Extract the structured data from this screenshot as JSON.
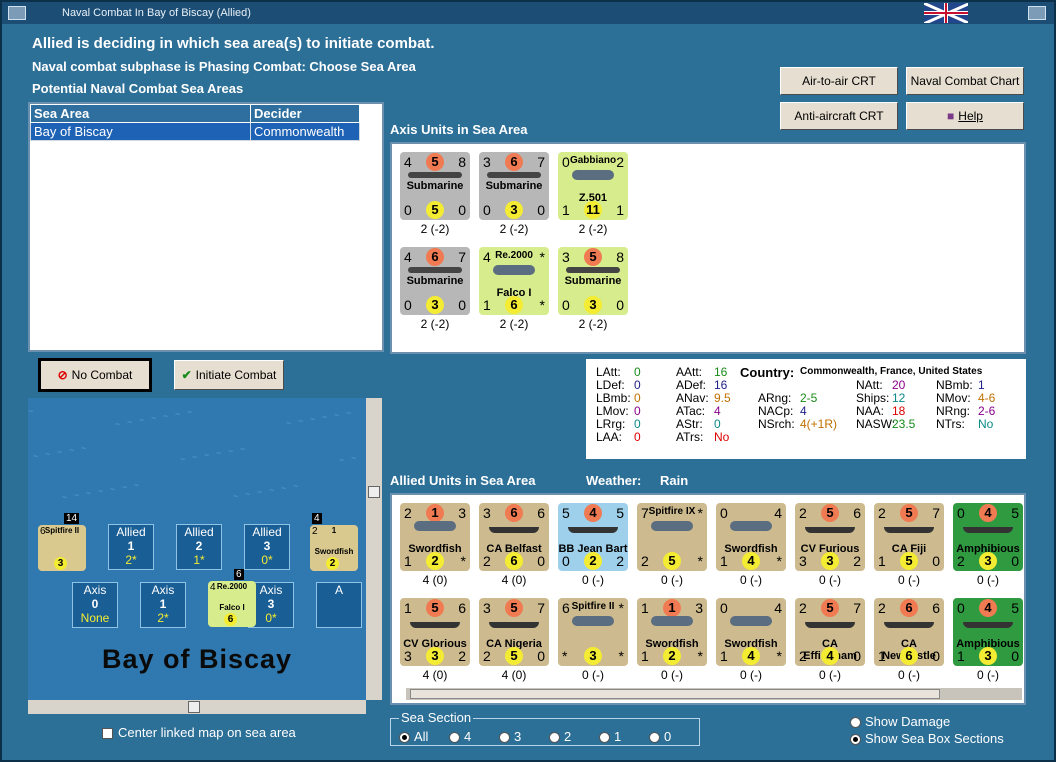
{
  "window": {
    "title": "Naval Combat In Bay of Biscay (Allied)"
  },
  "header": {
    "line1": "Allied is deciding in which sea area(s) to initiate combat.",
    "line2": "Naval combat subphase is Phasing Combat: Choose Sea Area",
    "line3": "Potential Naval Combat Sea Areas"
  },
  "buttons": {
    "air_to_air": "Air-to-air CRT",
    "naval_chart": "Naval Combat Chart",
    "anti_aircraft": "Anti-aircraft CRT",
    "help": "Help",
    "no_combat": "No Combat",
    "initiate_combat": "Initiate Combat"
  },
  "sea_table": {
    "headers": [
      "Sea Area",
      "Decider"
    ],
    "rows": [
      [
        "Bay of Biscay",
        "Commonwealth"
      ]
    ]
  },
  "axis_section": {
    "title": "Axis Units in Sea Area"
  },
  "allied_section": {
    "title": "Allied Units in Sea Area",
    "weather_label": "Weather:",
    "weather": "Rain"
  },
  "axis_units": [
    {
      "tl": "4",
      "tm": "5",
      "tr": "8",
      "name": "Submarine",
      "bl": "0",
      "bm": "5",
      "br": "0",
      "under": "2 (-2)",
      "color": "grey",
      "kind": "sub"
    },
    {
      "tl": "3",
      "tm": "6",
      "tr": "7",
      "name": "Submarine",
      "bl": "0",
      "bm": "3",
      "br": "0",
      "under": "2 (-2)",
      "color": "grey",
      "kind": "sub"
    },
    {
      "tl": "0",
      "tm": "Gabbiano",
      "tr": "2",
      "name": "Z.501",
      "bl": "1",
      "bm": "11",
      "br": "1",
      "under": "2 (-2)",
      "color": "yel",
      "kind": "plane"
    },
    {
      "tl": "4",
      "tm": "6",
      "tr": "7",
      "name": "Submarine",
      "bl": "0",
      "bm": "3",
      "br": "0",
      "under": "2 (-2)",
      "color": "grey",
      "kind": "sub"
    },
    {
      "tl": "4",
      "tm": "Re.2000",
      "tr": "*",
      "name": "Falco I",
      "bl": "1",
      "bm": "6",
      "br": "*",
      "under": "2 (-2)",
      "color": "yel",
      "kind": "plane"
    },
    {
      "tl": "3",
      "tm": "5",
      "tr": "8",
      "name": "Submarine",
      "bl": "0",
      "bm": "3",
      "br": "0",
      "under": "2 (-2)",
      "color": "yel",
      "kind": "sub"
    }
  ],
  "stats": {
    "country_label": "Country:",
    "country": "Commonwealth, France, United States",
    "items": [
      {
        "k": "LAtt:",
        "v": "0"
      },
      {
        "k": "LDef:",
        "v": "0"
      },
      {
        "k": "LBmb:",
        "v": "0"
      },
      {
        "k": "LMov:",
        "v": "0"
      },
      {
        "k": "LRrg:",
        "v": "0"
      },
      {
        "k": "LAA:",
        "v": "0"
      },
      {
        "k": "AAtt:",
        "v": "16"
      },
      {
        "k": "ADef:",
        "v": "16"
      },
      {
        "k": "ANav:",
        "v": "9.5"
      },
      {
        "k": "ATac:",
        "v": "4"
      },
      {
        "k": "AStr:",
        "v": "0"
      },
      {
        "k": "ATrs:",
        "v": "No"
      },
      {
        "k": "ARng:",
        "v": "2-5"
      },
      {
        "k": "NACp:",
        "v": "4"
      },
      {
        "k": "NSrch:",
        "v": "4(+1R)"
      },
      {
        "k": "NAtt:",
        "v": "20"
      },
      {
        "k": "Ships:",
        "v": "12"
      },
      {
        "k": "NAA:",
        "v": "18"
      },
      {
        "k": "NASW:",
        "v": "23.5"
      },
      {
        "k": "NBmb:",
        "v": "1"
      },
      {
        "k": "NMov:",
        "v": "4-6"
      },
      {
        "k": "NRng:",
        "v": "2-6"
      },
      {
        "k": "NTrs:",
        "v": "No"
      }
    ]
  },
  "allied_units": [
    {
      "tl": "2",
      "tm": "1",
      "tr": "3",
      "name": "Swordfish",
      "bl": "1",
      "bm": "2",
      "br": "*",
      "under": "4 (0)",
      "color": "tan",
      "kind": "plane"
    },
    {
      "tl": "3",
      "tm": "6",
      "tr": "6",
      "name": "CA Belfast",
      "bl": "2",
      "bm": "6",
      "br": "0",
      "under": "4 (0)",
      "color": "tan",
      "kind": "ship"
    },
    {
      "tl": "5",
      "tm": "4",
      "tr": "5",
      "name": "BB Jean Bart",
      "bl": "0",
      "bm": "2",
      "br": "2",
      "under": "0 (-)",
      "color": "blue",
      "kind": "ship"
    },
    {
      "tl": "7",
      "tm": "Spitfire IX",
      "tr": "*",
      "name": "",
      "bl": "2",
      "bm": "5",
      "br": "*",
      "under": "0 (-)",
      "color": "tan",
      "kind": "plane"
    },
    {
      "tl": "0",
      "tm": "",
      "tr": "4",
      "name": "Swordfish",
      "bl": "1",
      "bm": "4",
      "br": "*",
      "under": "0 (-)",
      "color": "tan",
      "kind": "plane"
    },
    {
      "tl": "2",
      "tm": "5",
      "tr": "6",
      "name": "CV Furious",
      "bl": "3",
      "bm": "3",
      "br": "2",
      "under": "0 (-)",
      "color": "tan",
      "kind": "ship"
    },
    {
      "tl": "2",
      "tm": "5",
      "tr": "7",
      "name": "CA Fiji",
      "bl": "1",
      "bm": "5",
      "br": "0",
      "under": "0 (-)",
      "color": "tan",
      "kind": "ship"
    },
    {
      "tl": "0",
      "tm": "4",
      "tr": "5",
      "name": "Amphibious",
      "bl": "2",
      "bm": "3",
      "br": "0",
      "under": "0 (-)",
      "color": "green",
      "kind": "ship"
    },
    {
      "tl": "1",
      "tm": "5",
      "tr": "6",
      "name": "CV Glorious",
      "bl": "3",
      "bm": "3",
      "br": "2",
      "under": "4 (0)",
      "color": "tan",
      "kind": "ship"
    },
    {
      "tl": "3",
      "tm": "5",
      "tr": "7",
      "name": "CA Nigeria",
      "bl": "2",
      "bm": "5",
      "br": "0",
      "under": "4 (0)",
      "color": "tan",
      "kind": "ship"
    },
    {
      "tl": "6",
      "tm": "Spitfire II",
      "tr": "*",
      "name": "",
      "bl": "*",
      "bm": "3",
      "br": "*",
      "under": "0 (-)",
      "color": "tan",
      "kind": "plane"
    },
    {
      "tl": "1",
      "tm": "1",
      "tr": "3",
      "name": "Swordfish",
      "bl": "1",
      "bm": "2",
      "br": "*",
      "under": "0 (-)",
      "color": "tan",
      "kind": "plane"
    },
    {
      "tl": "0",
      "tm": "",
      "tr": "4",
      "name": "Swordfish",
      "bl": "1",
      "bm": "4",
      "br": "*",
      "under": "0 (-)",
      "color": "tan",
      "kind": "plane"
    },
    {
      "tl": "2",
      "tm": "5",
      "tr": "7",
      "name": "CA Effingham",
      "bl": "2",
      "bm": "4",
      "br": "0",
      "under": "0 (-)",
      "color": "tan",
      "kind": "ship"
    },
    {
      "tl": "2",
      "tm": "6",
      "tr": "6",
      "name": "CA Newcastle",
      "bl": "1",
      "bm": "6",
      "br": "0",
      "under": "0 (-)",
      "color": "tan",
      "kind": "ship"
    },
    {
      "tl": "0",
      "tm": "4",
      "tr": "5",
      "name": "Amphibious",
      "bl": "1",
      "bm": "3",
      "br": "0",
      "under": "0 (-)",
      "color": "green",
      "kind": "ship"
    }
  ],
  "map": {
    "sea_name": "Bay of Biscay",
    "allied_zones": [
      {
        "label": "Allied",
        "num": "1",
        "val": "2*"
      },
      {
        "label": "Allied",
        "num": "2",
        "val": "1*"
      },
      {
        "label": "Allied",
        "num": "3",
        "val": "0*"
      }
    ],
    "axis_zones": [
      {
        "label": "Axis",
        "num": "0",
        "val": "None"
      },
      {
        "label": "Axis",
        "num": "1",
        "val": "2*"
      },
      {
        "label": "Axis",
        "num": "3",
        "val": "0*"
      },
      {
        "label": "A",
        "num": "",
        "val": ""
      }
    ],
    "stack_counts": [
      "14",
      "4",
      "6"
    ],
    "stack_left": {
      "tl": "6",
      "tm": "Spitfire II",
      "bm": "3"
    },
    "stack_right": {
      "tl": "2",
      "tm": "1",
      "name": "Swordfish",
      "bm": "2"
    },
    "stack_center": {
      "tl": "4",
      "tm": "Re.2000",
      "name": "Falco I",
      "bm": "6"
    }
  },
  "center_checkbox": "Center linked map on sea area",
  "sea_section": {
    "label": "Sea Section",
    "options": [
      "All",
      "4",
      "3",
      "2",
      "1",
      "0"
    ],
    "selected": "All"
  },
  "display_options": [
    {
      "label": "Show Damage",
      "selected": false
    },
    {
      "label": "Show Sea Box Sections",
      "selected": true
    }
  ],
  "colors": {
    "background": "#2c6f97",
    "counter_tan": "#cdbb8f",
    "counter_yellow": "#d7ec8c",
    "counter_grey": "#b7b7b7",
    "selected_row": "#1e62b6"
  }
}
